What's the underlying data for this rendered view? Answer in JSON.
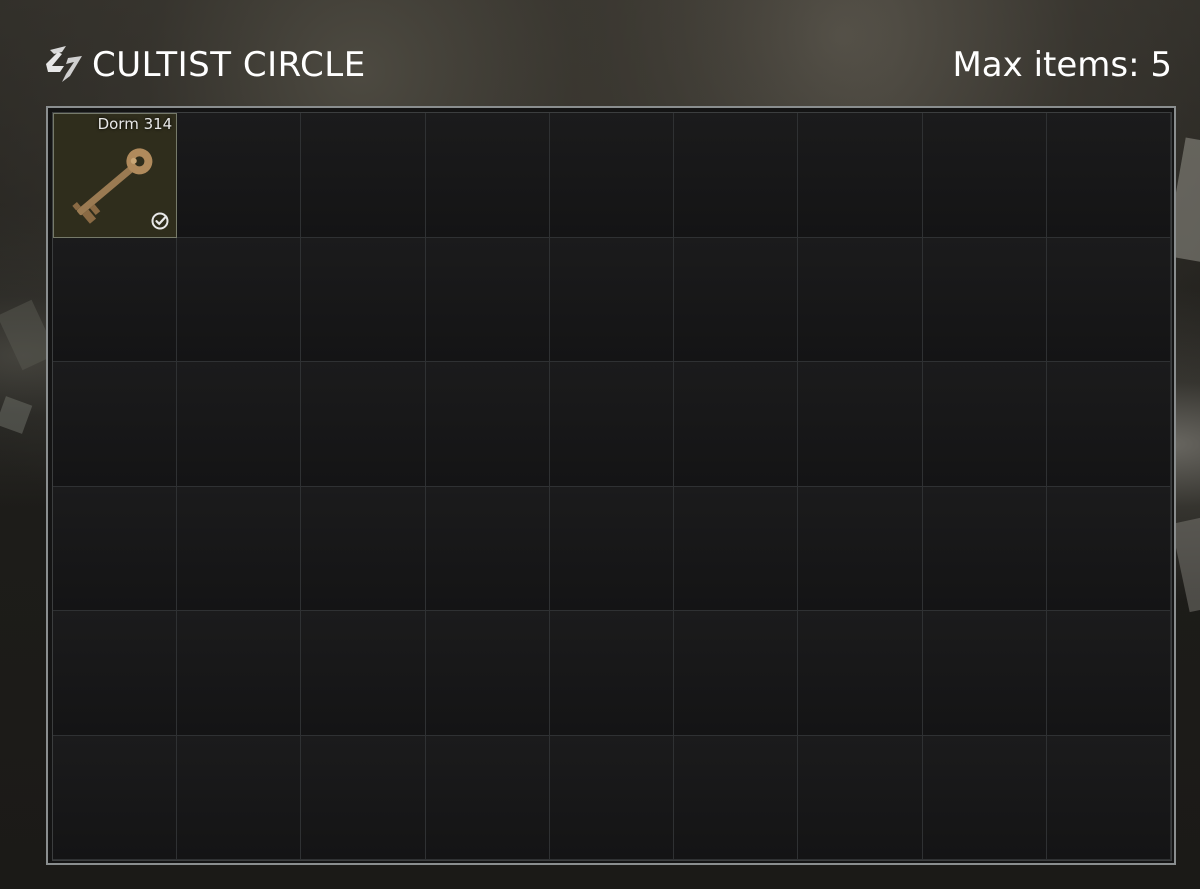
{
  "header": {
    "title": "CULTIST CIRCLE",
    "logo_icon": "cultist-circle-logo-icon"
  },
  "capacity": {
    "max_items_text": "Max items: 5"
  },
  "grid": {
    "columns": 9,
    "rows": 6,
    "items": [
      {
        "name": "Dorm 314",
        "icon": "key-icon",
        "status_icon": "check-circle-icon",
        "status": "found-in-raid"
      }
    ]
  },
  "colors": {
    "background": "#1a1917",
    "panel_border": "#8a8e8f",
    "cell_bg": "#161616",
    "item_bg": "#2f2d1c",
    "text": "#ffffff"
  }
}
